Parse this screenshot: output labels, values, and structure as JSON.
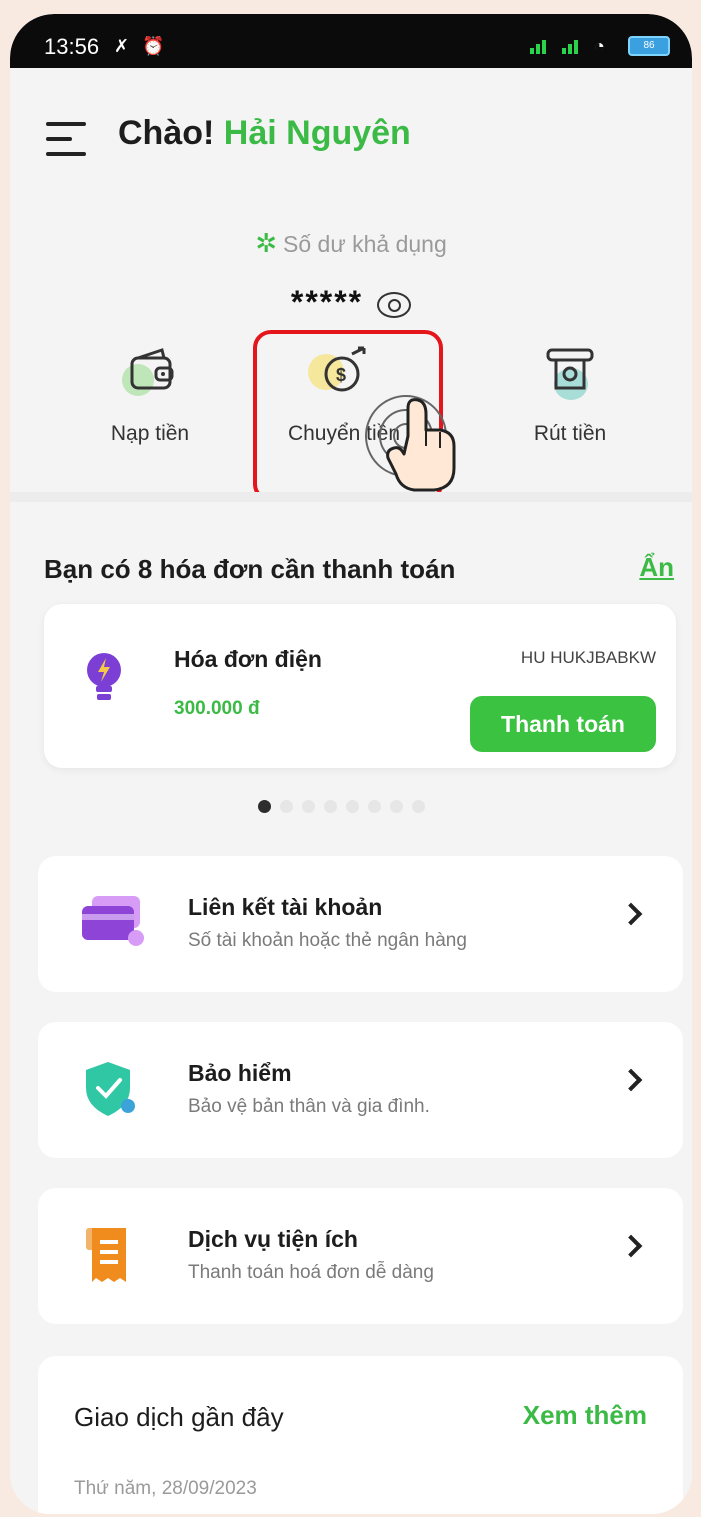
{
  "status_bar": {
    "time": "13:56",
    "battery": "86"
  },
  "header": {
    "greeting": "Chào!",
    "user_name": "Hải Nguyên"
  },
  "balance": {
    "label": "Số dư khả dụng",
    "value": "*****"
  },
  "actions": [
    {
      "label": "Nạp tiền",
      "icon": "wallet-icon"
    },
    {
      "label": "Chuyển tiền",
      "icon": "transfer-money-icon"
    },
    {
      "label": "Rút tiền",
      "icon": "atm-withdraw-icon"
    }
  ],
  "bills": {
    "title": "Bạn có 8 hóa đơn cần thanh toán",
    "hide_label": "Ẩn",
    "card": {
      "name": "Hóa đơn điện",
      "amount": "300.000 đ",
      "code": "HU HUKJBABKW",
      "pay_label": "Thanh toán"
    },
    "page_count": 8,
    "active_page": 1
  },
  "menu": [
    {
      "title": "Liên kết tài khoản",
      "subtitle": "Số tài khoản hoặc thẻ ngân hàng",
      "icon": "card-icon"
    },
    {
      "title": "Bảo hiểm",
      "subtitle": "Bảo vệ bản thân và gia đình.",
      "icon": "shield-check-icon"
    },
    {
      "title": "Dịch vụ tiện ích",
      "subtitle": "Thanh toán hoá đơn dễ dàng",
      "icon": "receipt-icon"
    }
  ],
  "recent": {
    "title": "Giao dịch gần đây",
    "more_label": "Xem thêm",
    "date": "Thứ năm, 28/09/2023"
  },
  "colors": {
    "brand_green": "#3cba46",
    "highlight_red": "#e4161c"
  }
}
